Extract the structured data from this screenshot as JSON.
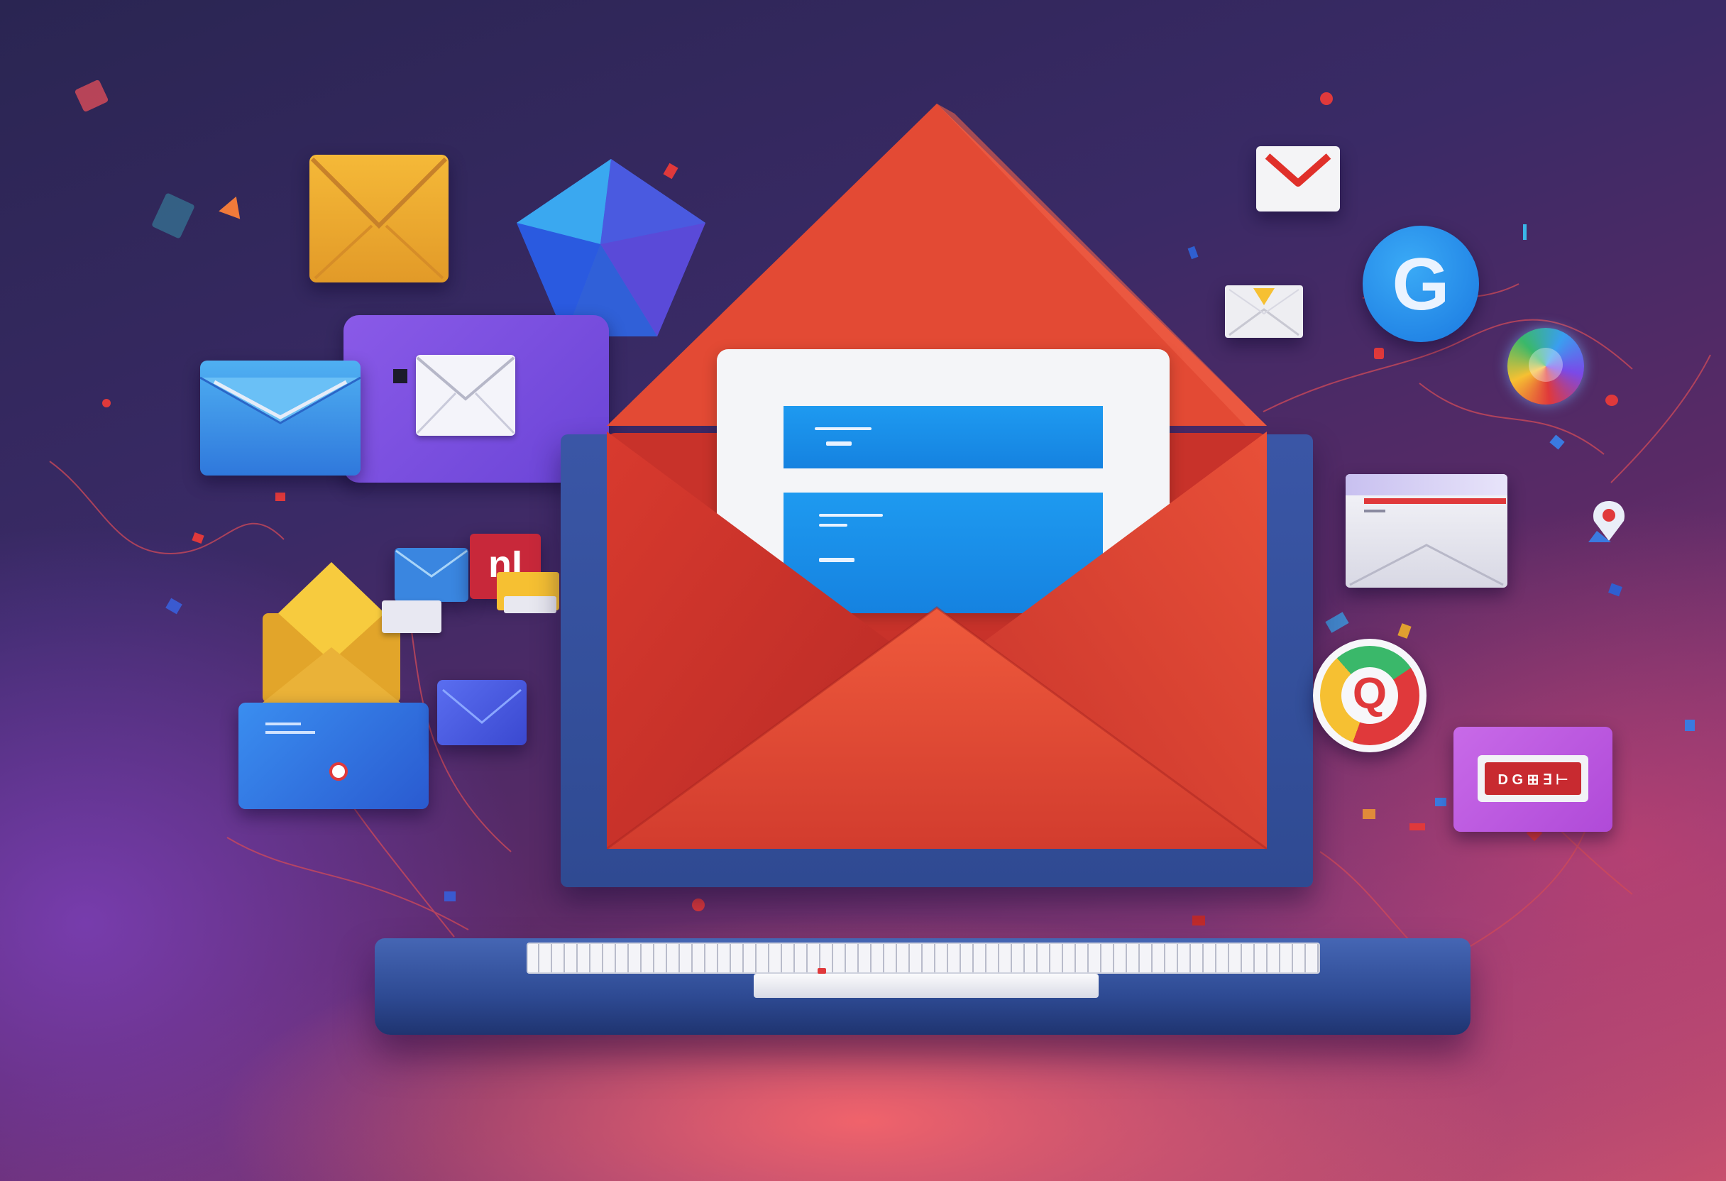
{
  "scene": {
    "palette": {
      "background_top": "#2a2552",
      "background_bottom": "#e8636c",
      "envelope_red": "#e0402f",
      "laptop_blue": "#3a56a6",
      "letter_blue": "#1e9af0",
      "google_blue": "#1a8fe8"
    },
    "icons": [
      "yellow-envelope-icon",
      "blue-gem-icon",
      "purple-mail-card-icon",
      "blue-envelope-icon",
      "gmail-envelope-icon",
      "google-g-icon",
      "colorful-orb-icon",
      "white-inbox-card-icon",
      "chrome-search-icon",
      "pink-badge-card-icon",
      "map-pin-icon",
      "red-m-tile-icon"
    ]
  },
  "badges": {
    "google_letter": "G",
    "search_letter": "Q",
    "red_tile_text": "nI",
    "pink_card_text": "D G ⊞ ∃ ⊢"
  }
}
